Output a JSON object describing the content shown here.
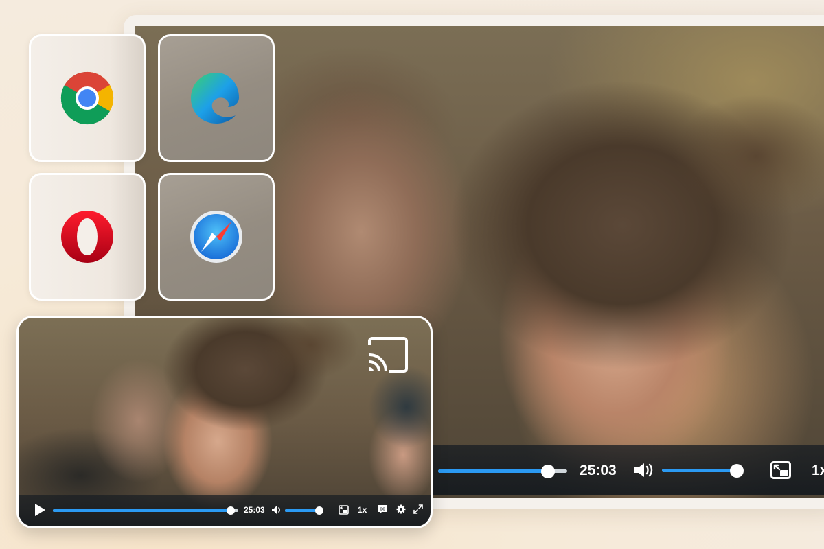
{
  "big_player": {
    "time": "25:03",
    "speed": "1x",
    "progress": 0.85,
    "volume": 0.97
  },
  "browsers": [
    {
      "name": "Chrome",
      "icon": "chrome-icon"
    },
    {
      "name": "Edge",
      "icon": "edge-icon"
    },
    {
      "name": "Opera",
      "icon": "opera-icon"
    },
    {
      "name": "Safari",
      "icon": "safari-icon"
    }
  ],
  "mini_player": {
    "time": "25:03",
    "speed": "1x",
    "progress": 0.96,
    "volume": 0.9,
    "cast_icon": "cast-icon"
  },
  "colors": {
    "accent": "#2b9af3",
    "control_bar": "#1c2126"
  }
}
